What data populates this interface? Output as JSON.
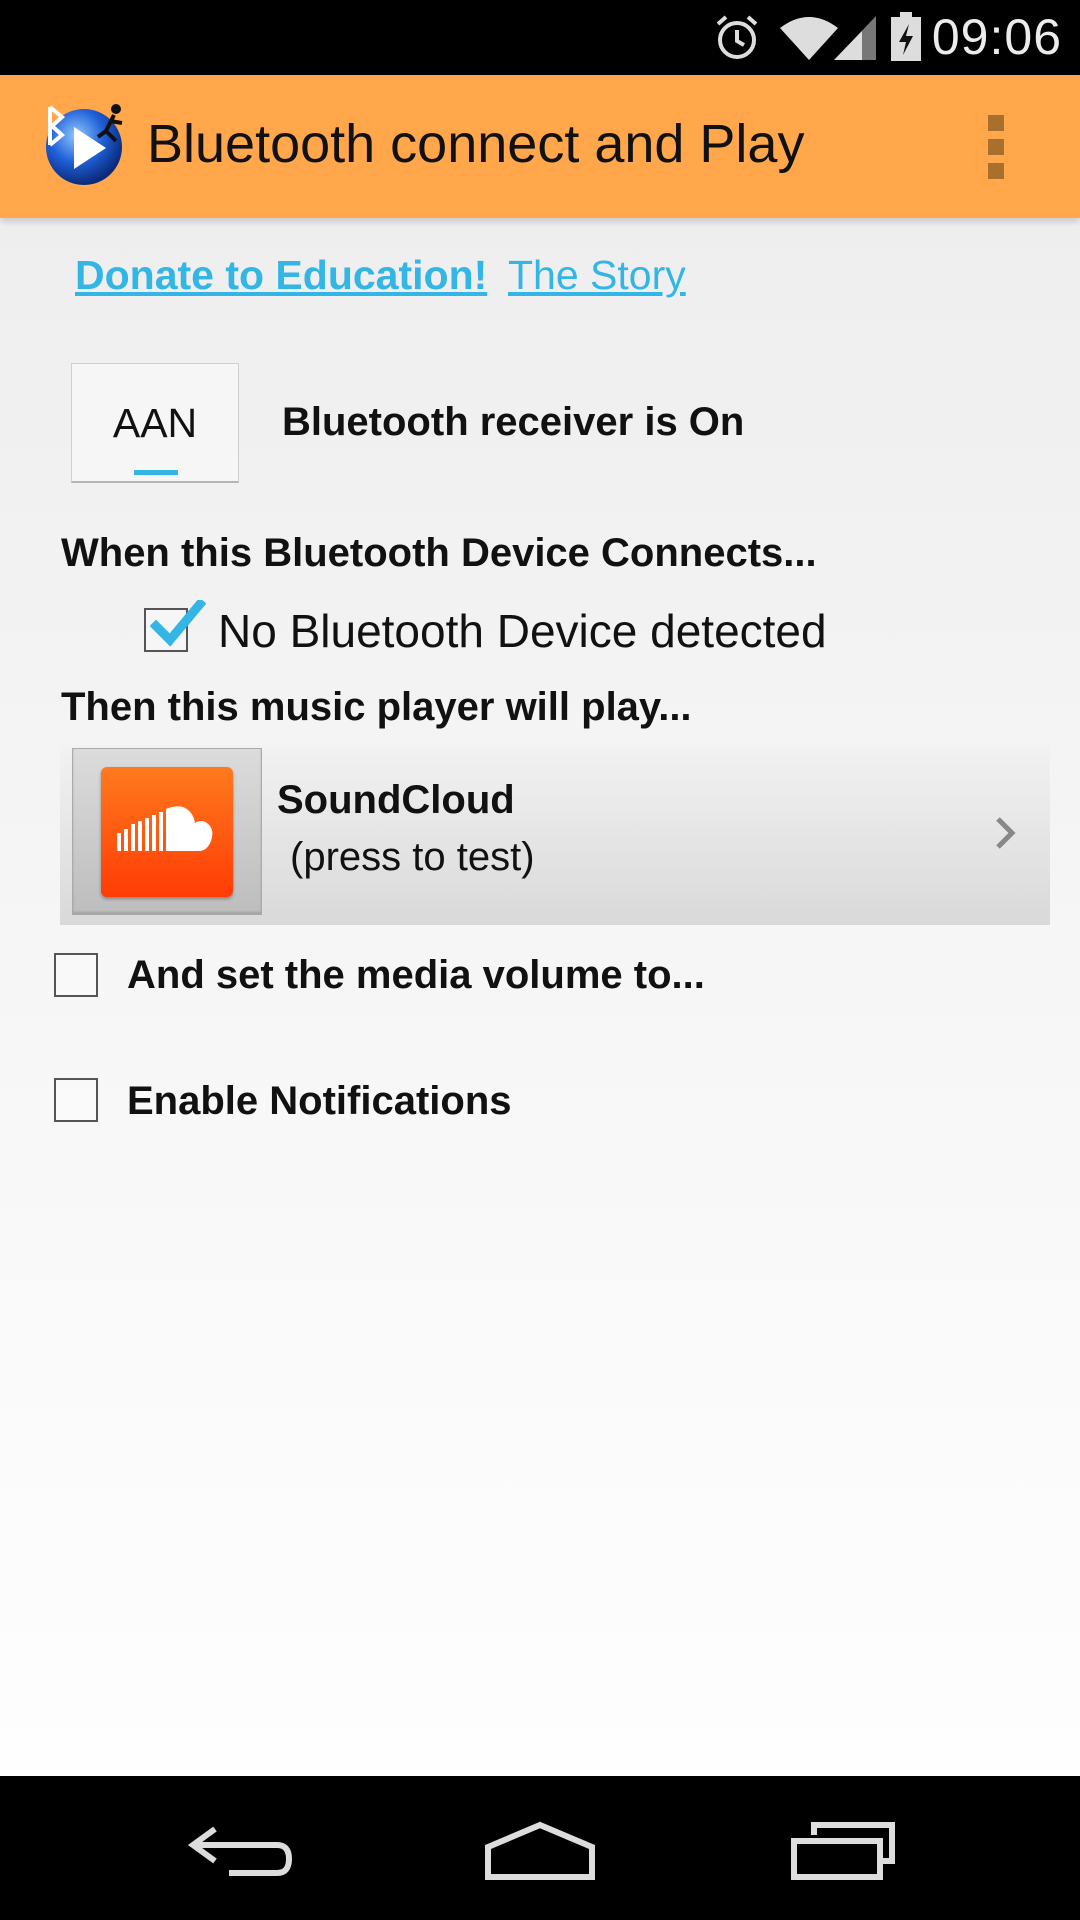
{
  "status_bar": {
    "time": "09:06",
    "icons": [
      "alarm-icon",
      "wifi-icon",
      "signal-icon",
      "battery-icon"
    ]
  },
  "action_bar": {
    "title": "Bluetooth connect and Play",
    "background_color": "#ffa74a",
    "icons": [
      "app-logo-icon",
      "overflow-menu-icon"
    ]
  },
  "links": {
    "donate": "Donate to Education!",
    "story": "The Story",
    "color": "#33b5e5"
  },
  "receiver": {
    "toggle_label": "AAN",
    "status": "Bluetooth receiver is On"
  },
  "device_section": {
    "heading": "When this Bluetooth Device Connects...",
    "device_label": "No Bluetooth Device detected",
    "device_checked": true
  },
  "player_section": {
    "heading": "Then this music player will play...",
    "player_name": "SoundCloud",
    "player_hint": "(press to test)",
    "icons": [
      "soundcloud-icon",
      "chevron-right-icon"
    ]
  },
  "options": {
    "volume_label": "And set the media volume to...",
    "volume_checked": false,
    "notifications_label": "Enable Notifications",
    "notifications_checked": false
  },
  "nav_bar": {
    "icons": [
      "back-icon",
      "home-icon",
      "recents-icon"
    ]
  }
}
